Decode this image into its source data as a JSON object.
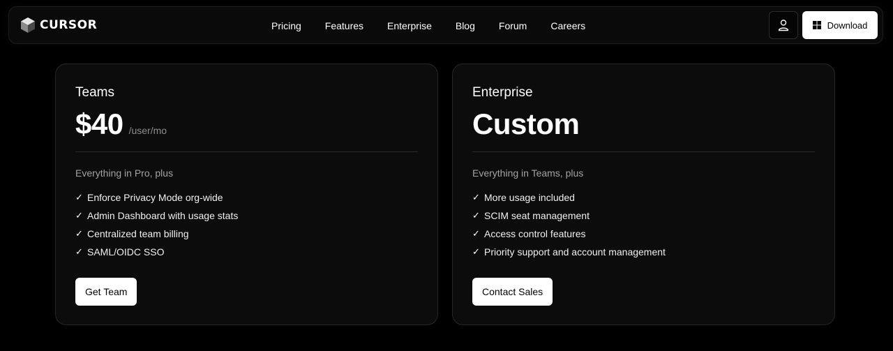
{
  "brand": {
    "name": "CURSOR",
    "logo_icon": "cube-logo-icon"
  },
  "nav": {
    "links": [
      "Pricing",
      "Features",
      "Enterprise",
      "Blog",
      "Forum",
      "Careers"
    ],
    "account_icon": "user-icon",
    "download_label": "Download",
    "download_icon": "windows-icon"
  },
  "plans": [
    {
      "name": "Teams",
      "price": "$40",
      "price_unit": "/user/mo",
      "subtitle": "Everything in Pro, plus",
      "features": [
        "Enforce Privacy Mode org-wide",
        "Admin Dashboard with usage stats",
        "Centralized team billing",
        "SAML/OIDC SSO"
      ],
      "cta": "Get Team"
    },
    {
      "name": "Enterprise",
      "price": "Custom",
      "price_unit": "",
      "subtitle": "Everything in Teams, plus",
      "features": [
        "More usage included",
        "SCIM seat management",
        "Access control features",
        "Priority support and account management"
      ],
      "cta": "Contact Sales"
    }
  ],
  "check_glyph": "✓",
  "colors": {
    "background": "#000000",
    "card": "#0c0c0c",
    "muted": "#8d8d8d",
    "cta": "#ffffff"
  }
}
